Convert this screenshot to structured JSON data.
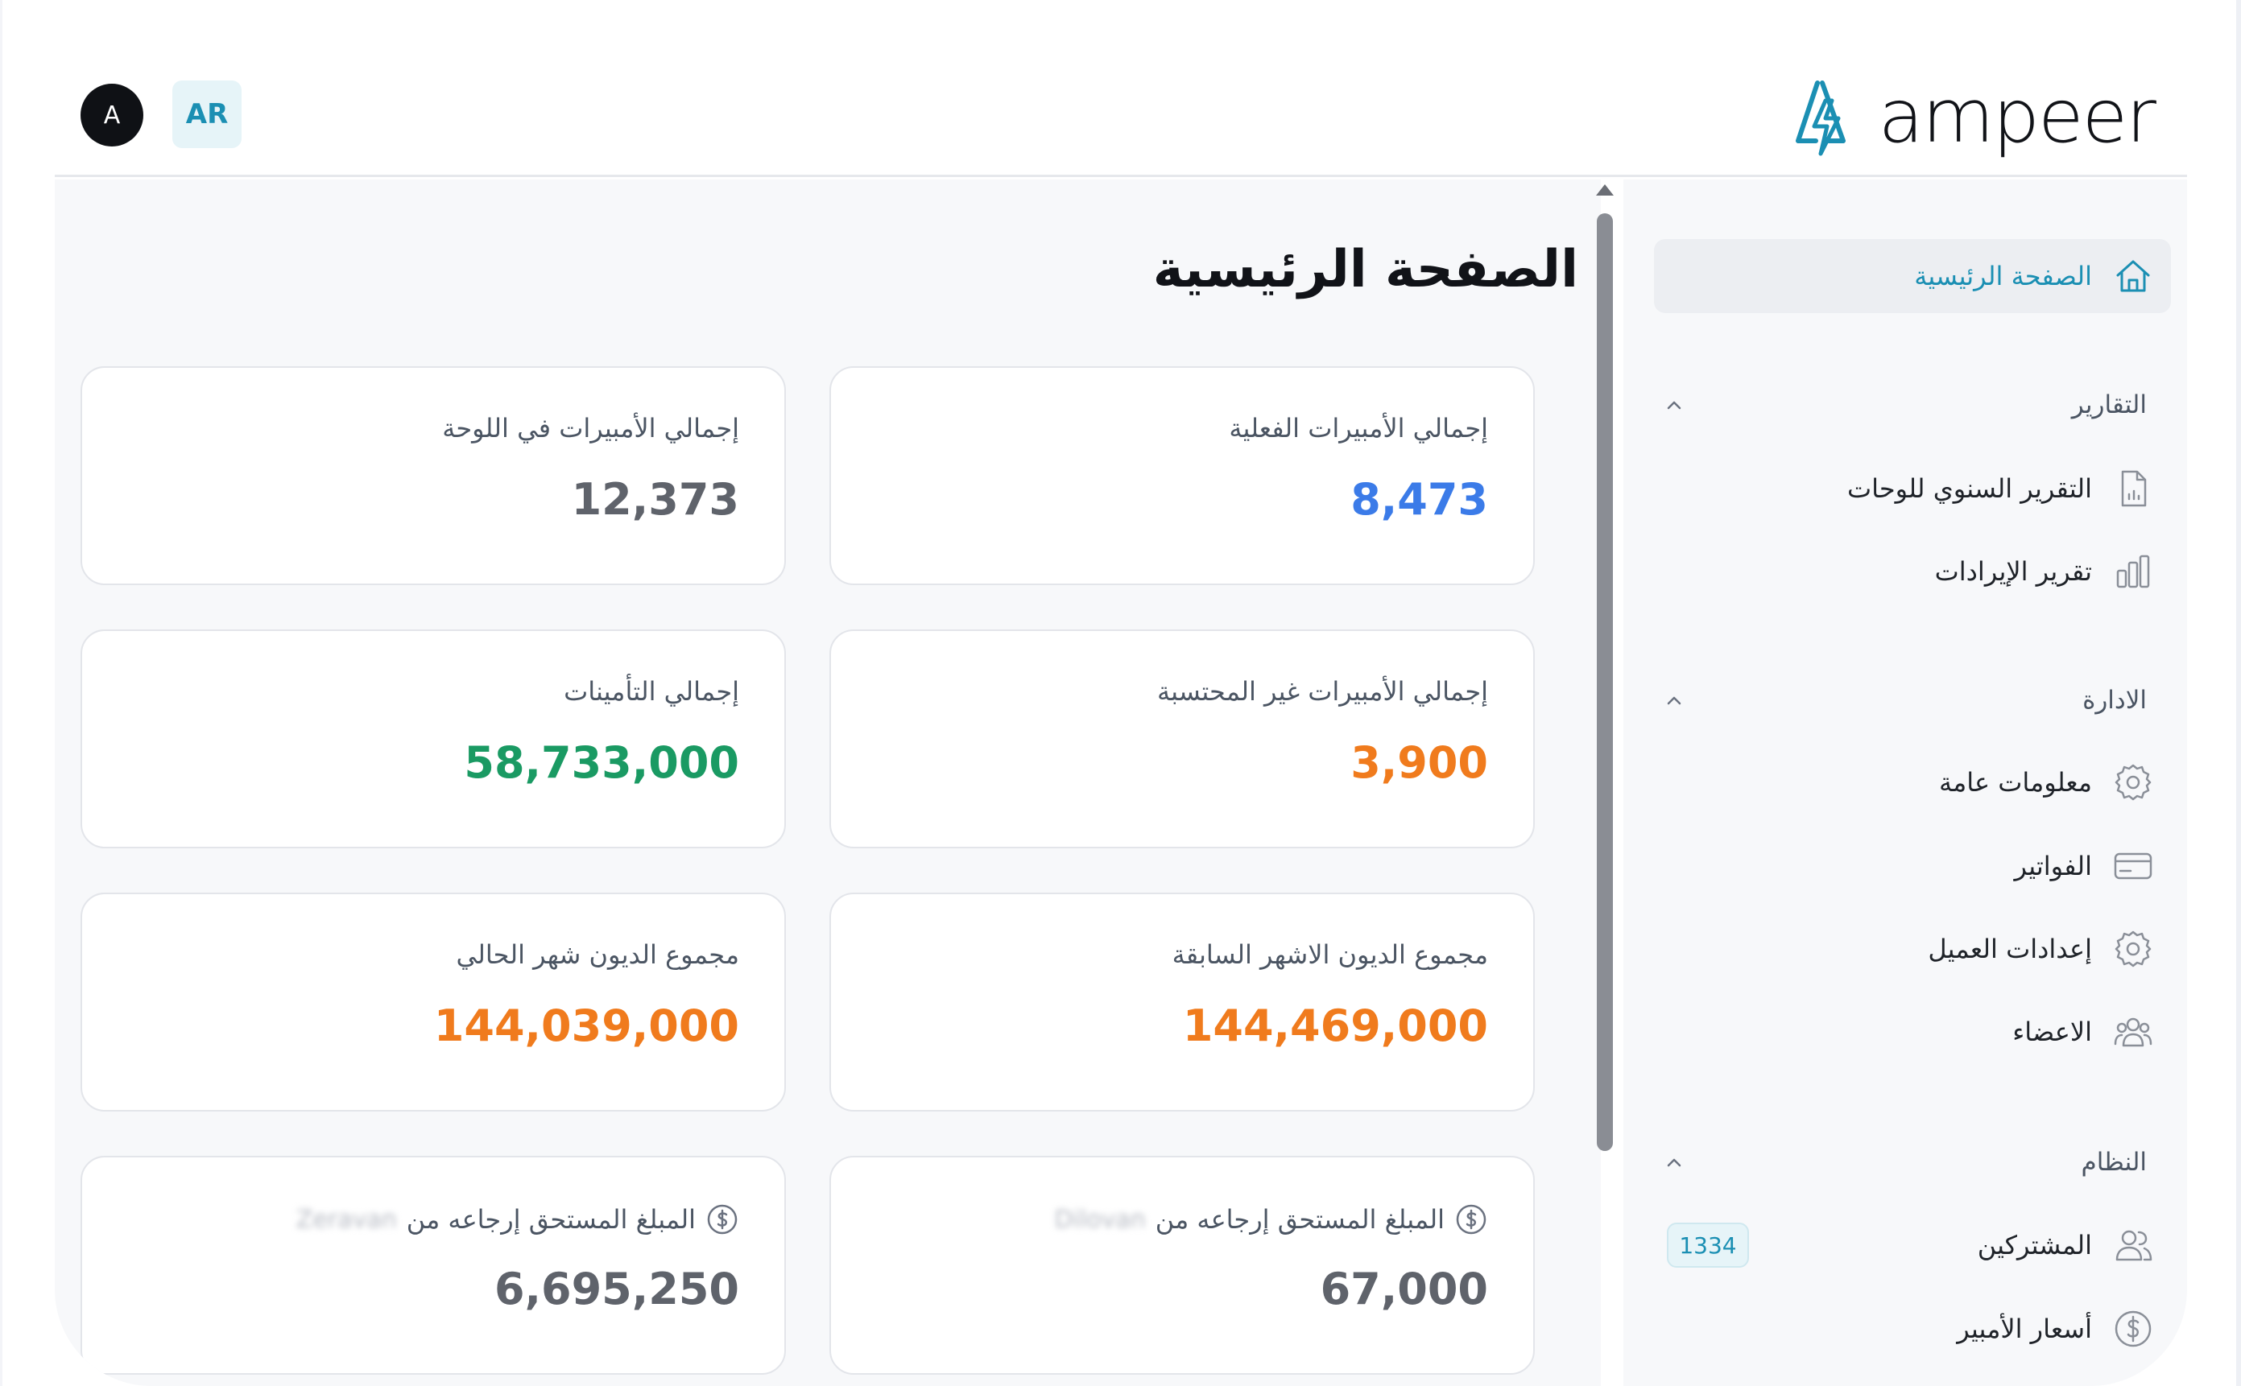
{
  "header": {
    "avatar_letter": "A",
    "language_button": "AR",
    "logo_text": "ampeer"
  },
  "main": {
    "title": "الصفحة الرئيسية",
    "cards": [
      {
        "label": "إجمالي الأمبيرات الفعلية",
        "value": "8,473",
        "color": "#3b7be8"
      },
      {
        "label": "إجمالي الأمبيرات في اللوحة",
        "value": "12,373",
        "color": "#5f636b"
      },
      {
        "label": "إجمالي الأمبيرات غير المحتسبة",
        "value": "3,900",
        "color": "#f07b1d"
      },
      {
        "label": "إجمالي التأمينات",
        "value": "58,733,000",
        "color": "#1a9a63"
      },
      {
        "label": "مجموع الديون الاشهر السابقة",
        "value": "144,469,000",
        "color": "#f07b1d"
      },
      {
        "label": "مجموع الديون شهر الحالي",
        "value": "144,039,000",
        "color": "#f07b1d"
      },
      {
        "label": "المبلغ المستحق إرجاعه من",
        "name": "Dilovan",
        "value": "67,000",
        "color": "#5f636b"
      },
      {
        "label": "المبلغ المستحق إرجاعه من",
        "name": "Zeravan",
        "value": "6,695,250",
        "color": "#5f636b"
      }
    ]
  },
  "sidebar": {
    "home": {
      "label": "الصفحة الرئيسية",
      "icon": "home-icon"
    },
    "sections": [
      {
        "title": "التقارير",
        "items": [
          {
            "label": "التقرير السنوي للوحات",
            "icon": "document-chart-icon"
          },
          {
            "label": "تقرير الإيرادات",
            "icon": "bar-chart-icon"
          }
        ]
      },
      {
        "title": "الادارة",
        "items": [
          {
            "label": "معلومات عامة",
            "icon": "gear-icon"
          },
          {
            "label": "الفواتير",
            "icon": "credit-card-icon"
          },
          {
            "label": "إعدادات العميل",
            "icon": "gear-icon"
          },
          {
            "label": "الاعضاء",
            "icon": "users-group-icon"
          }
        ]
      },
      {
        "title": "النظام",
        "items": [
          {
            "label": "المشتركين",
            "icon": "users-icon",
            "badge": "1334"
          },
          {
            "label": "أسعار الأمبير",
            "icon": "dollar-circle-icon"
          }
        ]
      }
    ]
  },
  "colors": {
    "accent": "#1b8fb3",
    "blue_value": "#3b7be8",
    "orange_value": "#f07b1d",
    "green_value": "#1a9a63",
    "gray_value": "#5f636b"
  }
}
